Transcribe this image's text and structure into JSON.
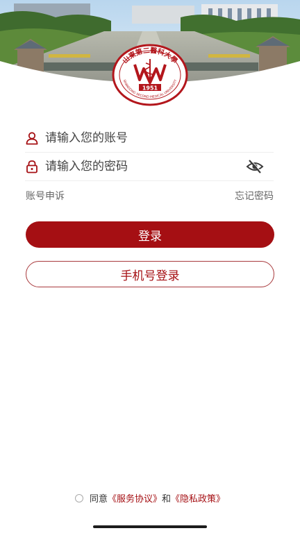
{
  "header": {
    "logo": {
      "top_arc_text": "山東第二醫科大學",
      "bottom_arc_text": "SHANDONG SECOND MEDICAL UNIVERSITY",
      "year": "1951",
      "color": "#b3161c"
    }
  },
  "login_form": {
    "account_placeholder": "请输入您的账号",
    "password_placeholder": "请输入您的密码",
    "account_icon": "user-icon",
    "password_icon": "lock-icon",
    "visibility_icon": "eye-off-icon",
    "appeal_link": "账号申诉",
    "forgot_link": "忘记密码",
    "login_button": "登录",
    "phone_login_button": "手机号登录"
  },
  "agreement": {
    "prefix": "同意",
    "service_agreement": "《服务协议》",
    "and": "和",
    "privacy_policy": "《隐私政策》"
  },
  "colors": {
    "brand": "#a50f13",
    "button_border": "#a8393c",
    "text_muted": "#666666"
  }
}
